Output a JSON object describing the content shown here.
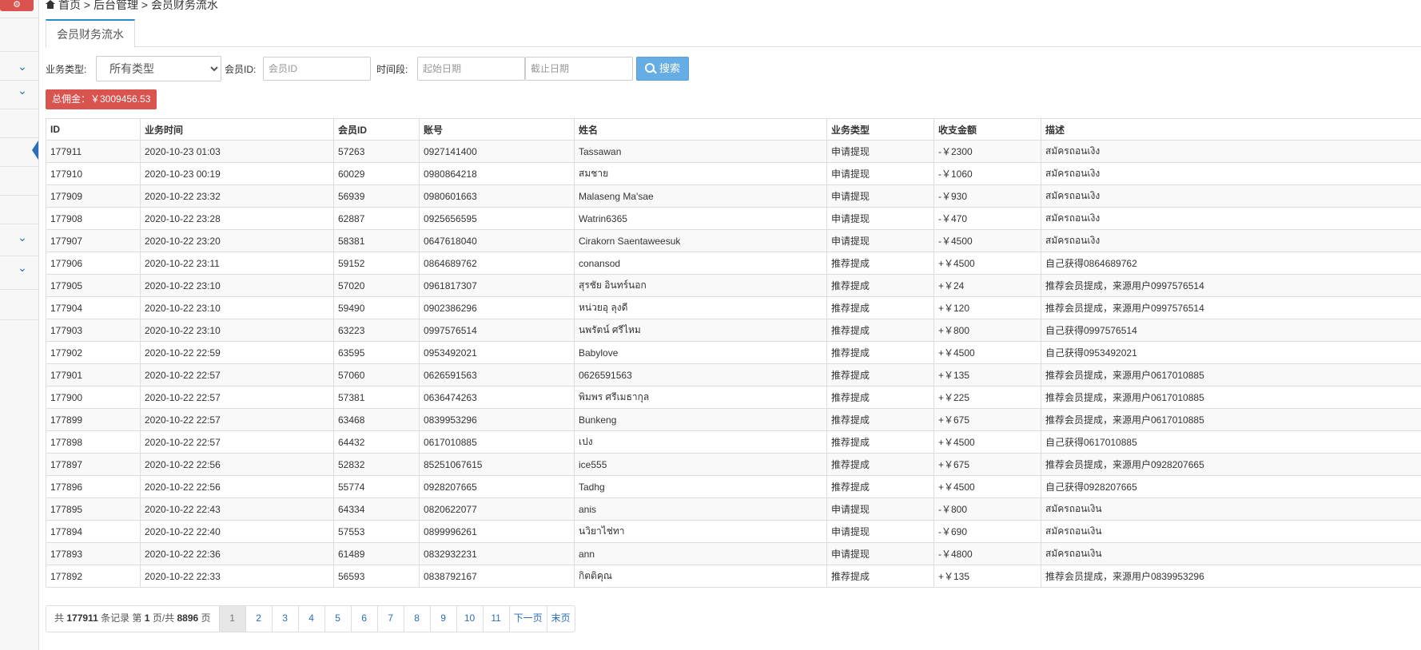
{
  "breadcrumb": {
    "home": "首页",
    "sep": ">",
    "admin": "后台管理",
    "current": "会员财务流水"
  },
  "tab": {
    "label": "会员财务流水"
  },
  "filter": {
    "type_label": "业务类型:",
    "type_selected": "所有类型",
    "member_label": "会员ID:",
    "member_placeholder": "会员ID",
    "period_label": "时间段:",
    "start_placeholder": "起始日期",
    "end_placeholder": "截止日期",
    "search_label": "搜索"
  },
  "total_badge": "总佣金：￥3009456.53",
  "table": {
    "headers": [
      "ID",
      "业务时间",
      "会员ID",
      "账号",
      "姓名",
      "业务类型",
      "收支金额",
      "描述"
    ],
    "rows": [
      [
        "177911",
        "2020-10-23 01:03",
        "57263",
        "0927141400",
        "Tassawan",
        "申请提现",
        "-￥2300",
        "สมัครถอนเงิง"
      ],
      [
        "177910",
        "2020-10-23 00:19",
        "60029",
        "0980864218",
        "สมชาย",
        "申请提现",
        "-￥1060",
        "สมัครถอนเงิง"
      ],
      [
        "177909",
        "2020-10-22 23:32",
        "56939",
        "0980601663",
        "Malaseng Ma'sae",
        "申请提现",
        "-￥930",
        "สมัครถอนเงิง"
      ],
      [
        "177908",
        "2020-10-22 23:28",
        "62887",
        "0925656595",
        "Watrin6365",
        "申请提现",
        "-￥470",
        "สมัครถอนเงิง"
      ],
      [
        "177907",
        "2020-10-22 23:20",
        "58381",
        "0647618040",
        "Cirakorn Saentaweesuk",
        "申请提现",
        "-￥4500",
        "สมัครถอนเงิง"
      ],
      [
        "177906",
        "2020-10-22 23:11",
        "59152",
        "0864689762",
        "conansod",
        "推荐提成",
        "+￥4500",
        "自己获得0864689762"
      ],
      [
        "177905",
        "2020-10-22 23:10",
        "57020",
        "0961817307",
        "สุรชัย อินทร์นอก",
        "推荐提成",
        "+￥24",
        "推荐会员提成，来源用户0997576514"
      ],
      [
        "177904",
        "2020-10-22 23:10",
        "59490",
        "0902386296",
        "หน่วยอุ ลุงดี",
        "推荐提成",
        "+￥120",
        "推荐会员提成，来源用户0997576514"
      ],
      [
        "177903",
        "2020-10-22 23:10",
        "63223",
        "0997576514",
        "นพรัตน์ ศรีไหม",
        "推荐提成",
        "+￥800",
        "自己获得0997576514"
      ],
      [
        "177902",
        "2020-10-22 22:59",
        "63595",
        "0953492021",
        "Babylove",
        "推荐提成",
        "+￥4500",
        "自己获得0953492021"
      ],
      [
        "177901",
        "2020-10-22 22:57",
        "57060",
        "0626591563",
        "0626591563",
        "推荐提成",
        "+￥135",
        "推荐会员提成，来源用户0617010885"
      ],
      [
        "177900",
        "2020-10-22 22:57",
        "57381",
        "0636474263",
        "พิมพร ศรีเมธากุล",
        "推荐提成",
        "+￥225",
        "推荐会员提成，来源用户0617010885"
      ],
      [
        "177899",
        "2020-10-22 22:57",
        "63468",
        "0839953296",
        "Bunkeng",
        "推荐提成",
        "+￥675",
        "推荐会员提成，来源用户0617010885"
      ],
      [
        "177898",
        "2020-10-22 22:57",
        "64432",
        "0617010885",
        "เปง",
        "推荐提成",
        "+￥4500",
        "自己获得0617010885"
      ],
      [
        "177897",
        "2020-10-22 22:56",
        "52832",
        "85251067615",
        "ice555",
        "推荐提成",
        "+￥675",
        "推荐会员提成，来源用户0928207665"
      ],
      [
        "177896",
        "2020-10-22 22:56",
        "55774",
        "0928207665",
        "Tadhg",
        "推荐提成",
        "+￥4500",
        "自己获得0928207665"
      ],
      [
        "177895",
        "2020-10-22 22:43",
        "64334",
        "0820622077",
        "anis",
        "申请提现",
        "-￥800",
        "สมัครถอนเงิน"
      ],
      [
        "177894",
        "2020-10-22 22:40",
        "57553",
        "0899996261",
        "นวิยาไช่ทา",
        "申请提现",
        "-￥690",
        "สมัครถอนเงิน"
      ],
      [
        "177893",
        "2020-10-22 22:36",
        "61489",
        "0832932231",
        "ann",
        "申请提现",
        "-￥4800",
        "สมัครถอนเงิน"
      ],
      [
        "177892",
        "2020-10-22 22:33",
        "56593",
        "0838792167",
        "กิตติคุณ",
        "推荐提成",
        "+￥135",
        "推荐会员提成，来源用户0839953296"
      ]
    ]
  },
  "pager": {
    "prefix": "共",
    "total": "177911",
    "mid1": "条记录 第",
    "page": "1",
    "mid2": "页/共",
    "pages": "8896",
    "suffix": "页",
    "numbers": [
      "1",
      "2",
      "3",
      "4",
      "5",
      "6",
      "7",
      "8",
      "9",
      "10",
      "11"
    ],
    "next": "下一页",
    "last": "末页"
  },
  "colors": {
    "accent": "#2a6ebb",
    "danger": "#d9534f",
    "search": "#66ade6"
  }
}
